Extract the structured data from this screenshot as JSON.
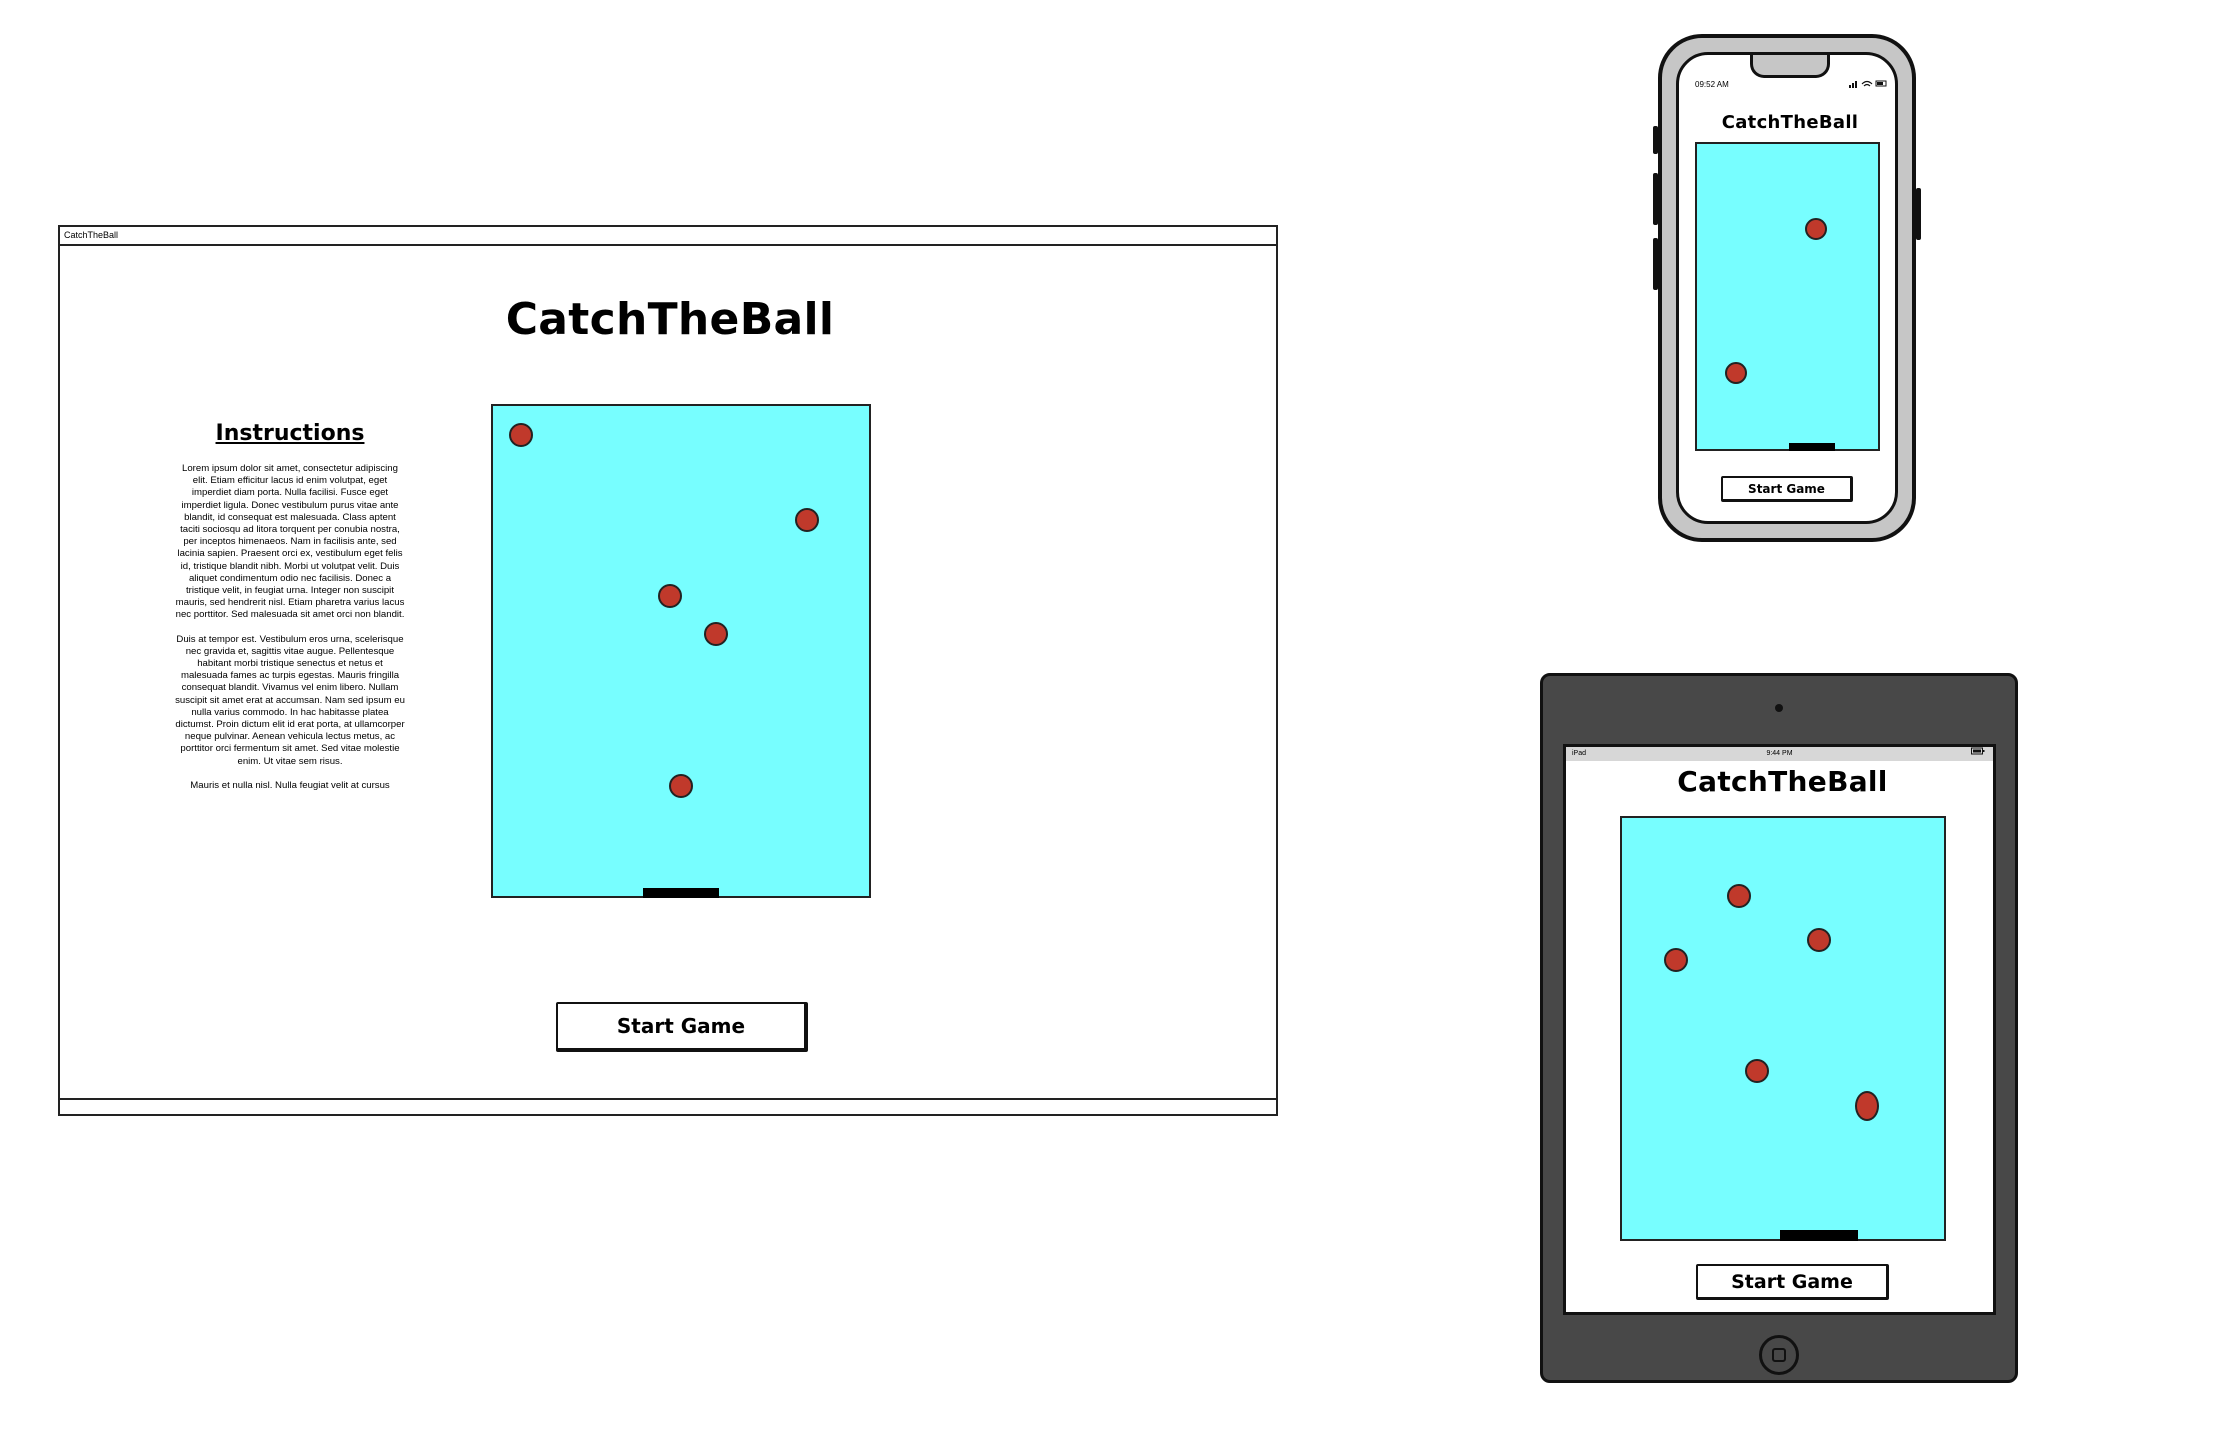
{
  "desktop": {
    "window_title": "CatchTheBall",
    "title": "CatchTheBall",
    "instructions_heading": "Instructions",
    "instructions_paragraphs": [
      "Lorem ipsum dolor sit amet, consectetur adipiscing elit. Etiam efficitur lacus id enim volutpat, eget imperdiet diam porta. Nulla facilisi. Fusce eget imperdiet ligula. Donec vestibulum purus vitae ante blandit, id consequat est malesuada. Class aptent taciti sociosqu ad litora torquent per conubia nostra, per inceptos himenaeos. Nam in facilisis ante, sed lacinia sapien. Praesent orci ex, vestibulum eget felis id, tristique blandit nibh. Morbi ut volutpat velit. Duis aliquet condimentum odio nec facilisis. Donec a tristique velit, in feugiat urna. Integer non suscipit mauris, sed hendrerit nisl. Etiam pharetra varius lacus nec porttitor. Sed malesuada sit amet orci non blandit.",
      "Duis at tempor est. Vestibulum eros urna, scelerisque nec gravida et, sagittis vitae augue. Pellentesque habitant morbi tristique senectus et netus et malesuada fames ac turpis egestas. Mauris fringilla consequat blandit. Vivamus vel enim libero. Nullam suscipit sit amet erat at accumsan. Nam sed ipsum eu nulla varius commodo. In hac habitasse platea dictumst. Proin dictum elit id erat porta, at ullamcorper neque pulvinar. Aenean vehicula lectus metus, ac porttitor orci fermentum sit amet. Sed vitae molestie enim. Ut vitae sem risus.",
      "Mauris et nulla nisl. Nulla feugiat velit at cursus"
    ],
    "start_button": "Start Game",
    "ball_count": 5
  },
  "phone": {
    "time": "09:52 AM",
    "status_icons": "signal wifi battery",
    "title": "CatchTheBall",
    "start_button": "Start Game",
    "ball_count": 2
  },
  "tablet": {
    "status_left": "iPad",
    "status_time": "9:44 PM",
    "status_right": "battery",
    "title": "CatchTheBall",
    "start_button": "Start Game",
    "ball_count": 5
  },
  "colors": {
    "field": "#77feff",
    "ball": "#c0392b",
    "paddle": "#000000",
    "phone_bezel": "#c6c6c6",
    "tablet_bezel": "#484848"
  }
}
